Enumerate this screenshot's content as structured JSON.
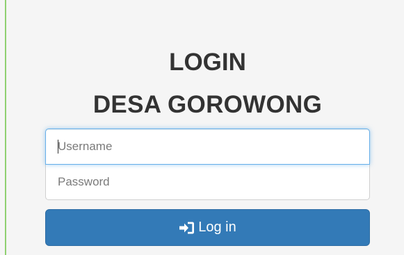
{
  "header": {
    "title_line1": "LOGIN",
    "title_line2": "DESA GOROWONG"
  },
  "form": {
    "username": {
      "value": "",
      "placeholder": "Username"
    },
    "password": {
      "value": "",
      "placeholder": "Password"
    },
    "submit_label": "Log in",
    "submit_icon": "log-in-icon"
  },
  "colors": {
    "primary_button": "#337ab7",
    "focus_border": "#66afe9",
    "left_accent": "#8fd070",
    "title_text": "#333333"
  }
}
